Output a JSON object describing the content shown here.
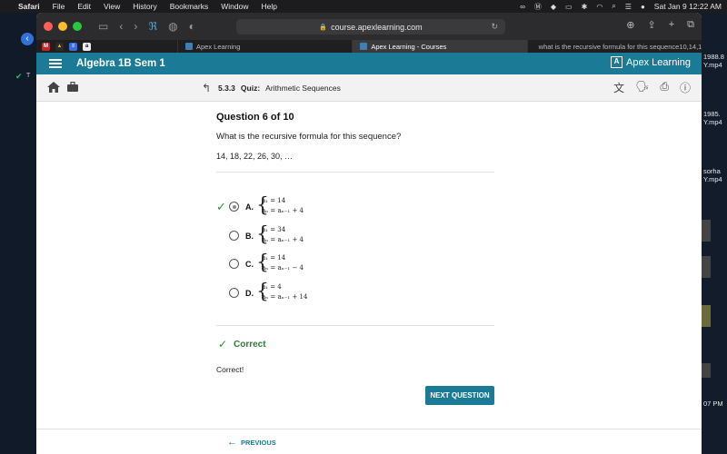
{
  "menubar": {
    "apple": "",
    "items": [
      "Safari",
      "File",
      "Edit",
      "View",
      "History",
      "Bookmarks",
      "Window",
      "Help"
    ],
    "datetime": "Sat Jan 9  12:22 AM"
  },
  "desktop": {
    "right_labels": [
      "1988.8",
      "Y.mp4",
      "1985.",
      "Y.mp4",
      "sorha",
      "Y.mp4",
      "07 PM"
    ],
    "left_label": "T"
  },
  "browser": {
    "url": "course.apexlearning.com",
    "tabs": [
      {
        "label": "Apex Learning",
        "active": false
      },
      {
        "label": "Apex Learning - Courses",
        "active": true
      },
      {
        "label": "what is the recursive formula for this sequence10,14,18,22,26...",
        "active": false
      }
    ]
  },
  "apex": {
    "course_title": "Algebra 1B Sem 1",
    "logo_text": "Apex Learning"
  },
  "subnav": {
    "section_number": "5.3.3",
    "section_type": "Quiz:",
    "section_title": "Arithmetic Sequences"
  },
  "question": {
    "number_label": "Question 6 of 10",
    "prompt": "What is the recursive formula for this sequence?",
    "sequence": "14, 18, 22, 26, 30, …",
    "choices": [
      {
        "letter": "A.",
        "line1": "a₁ = 14",
        "line2": "aₙ = aₙ₋₁ + 4",
        "selected": true,
        "correct": true
      },
      {
        "letter": "B.",
        "line1": "a₁ = 34",
        "line2": "aₙ = aₙ₋₁ + 4",
        "selected": false,
        "correct": false
      },
      {
        "letter": "C.",
        "line1": "a₁ = 14",
        "line2": "aₙ = aₙ₋₁ − 4",
        "selected": false,
        "correct": false
      },
      {
        "letter": "D.",
        "line1": "a₁ = 4",
        "line2": "aₙ = aₙ₋₁ + 14",
        "selected": false,
        "correct": false
      }
    ]
  },
  "result": {
    "label": "Correct",
    "feedback": "Correct!",
    "next_label": "NEXT QUESTION",
    "previous_label": "PREVIOUS"
  },
  "colors": {
    "brand": "#1b7a95",
    "correct": "#2e7a3a"
  }
}
